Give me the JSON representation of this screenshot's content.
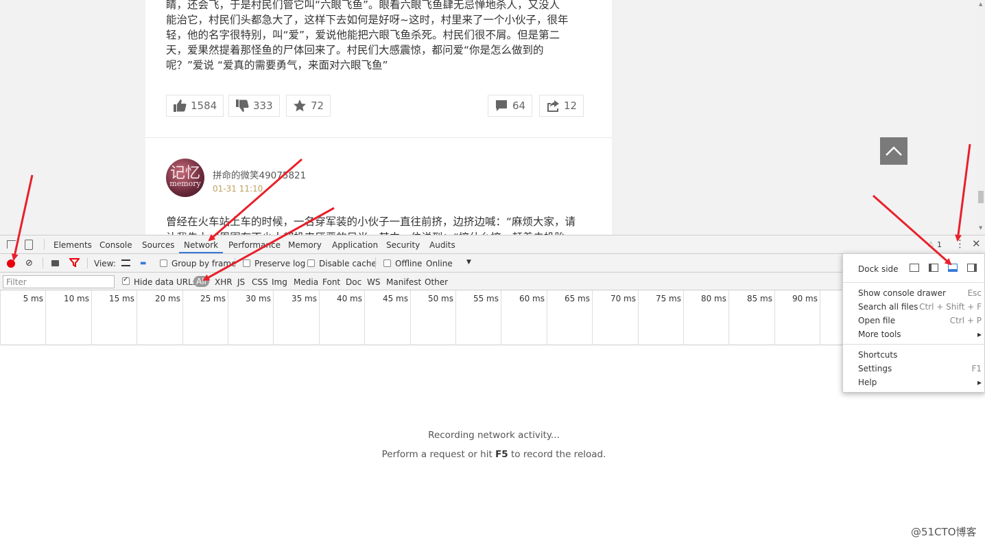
{
  "page": {
    "story_lines": [
      "睛，还会飞，于是村民们管它叫“六眼飞鱼”。眼看六眼飞鱼肆无忌惮地杀人，又没人",
      "能治它，村民们头都急大了，这样下去如何是好呀~这时，村里来了一个小伙子，很年",
      "轻，他的名字很特别，叫“爱”，爱说他能把六眼飞鱼杀死。村民们很不屑。但是第二",
      "天，爱果然提着那怪鱼的尸体回来了。村民们大感震惊，都问爱“你是怎么做到的",
      "呢？”爱说 “爱真的需要勇气，来面对六眼飞鱼”"
    ],
    "actions": {
      "like_count": "1584",
      "dislike_count": "333",
      "fav_count": "72",
      "comment_count": "64",
      "share_count": "12"
    },
    "post2": {
      "avatar_text": "记忆",
      "avatar_sub": "memory",
      "author": "拼命的微笑49075821",
      "time": "01-31 11:10",
      "text_line1": "曾经在火车站上车的时候，一名穿军装的小伙子一直往前挤，边挤边喊：“麻烦大家，请",
      "text_line2": "让我先上，”周围有不少人都投来厌恶的目光，其中一位说到：“挤什么挤，赶着去投胎"
    }
  },
  "devtools": {
    "tabs": [
      "Elements",
      "Console",
      "Sources",
      "Network",
      "Performance",
      "Memory",
      "Application",
      "Security",
      "Audits"
    ],
    "active_tab": "Network",
    "warning_count": "1",
    "toolbar": {
      "view_label": "View:",
      "group_by_frame": "Group by frame",
      "preserve_log": "Preserve log",
      "disable_cache": "Disable cache",
      "offline": "Offline",
      "throttle": "Online"
    },
    "filter": {
      "placeholder": "Filter",
      "hide_data_urls": "Hide data URLs",
      "types": [
        "All",
        "XHR",
        "JS",
        "CSS",
        "Img",
        "Media",
        "Font",
        "Doc",
        "WS",
        "Manifest",
        "Other"
      ]
    },
    "timeline_labels": [
      "5 ms",
      "10 ms",
      "15 ms",
      "20 ms",
      "25 ms",
      "30 ms",
      "35 ms",
      "40 ms",
      "45 ms",
      "50 ms",
      "55 ms",
      "60 ms",
      "65 ms",
      "70 ms",
      "75 ms",
      "80 ms",
      "85 ms",
      "90 ms"
    ],
    "empty_line1": "Recording network activity...",
    "empty_line2_pre": "Perform a request or hit ",
    "empty_line2_key": "F5",
    "empty_line2_post": " to record the reload."
  },
  "menu": {
    "dock_side": "Dock side",
    "items": [
      {
        "label": "Show console drawer",
        "key": "Esc"
      },
      {
        "label": "Search all files",
        "key": "Ctrl + Shift + F"
      },
      {
        "label": "Open file",
        "key": "Ctrl + P"
      },
      {
        "label": "More tools",
        "key": "▸"
      },
      {
        "label": "Shortcuts",
        "key": ""
      },
      {
        "label": "Settings",
        "key": "F1"
      },
      {
        "label": "Help",
        "key": "▸"
      }
    ]
  },
  "watermark": "@51CTO博客",
  "colors": {
    "record_red": "#e8000e",
    "accent_blue": "#3879d9",
    "arrow_red": "#e8202a"
  }
}
